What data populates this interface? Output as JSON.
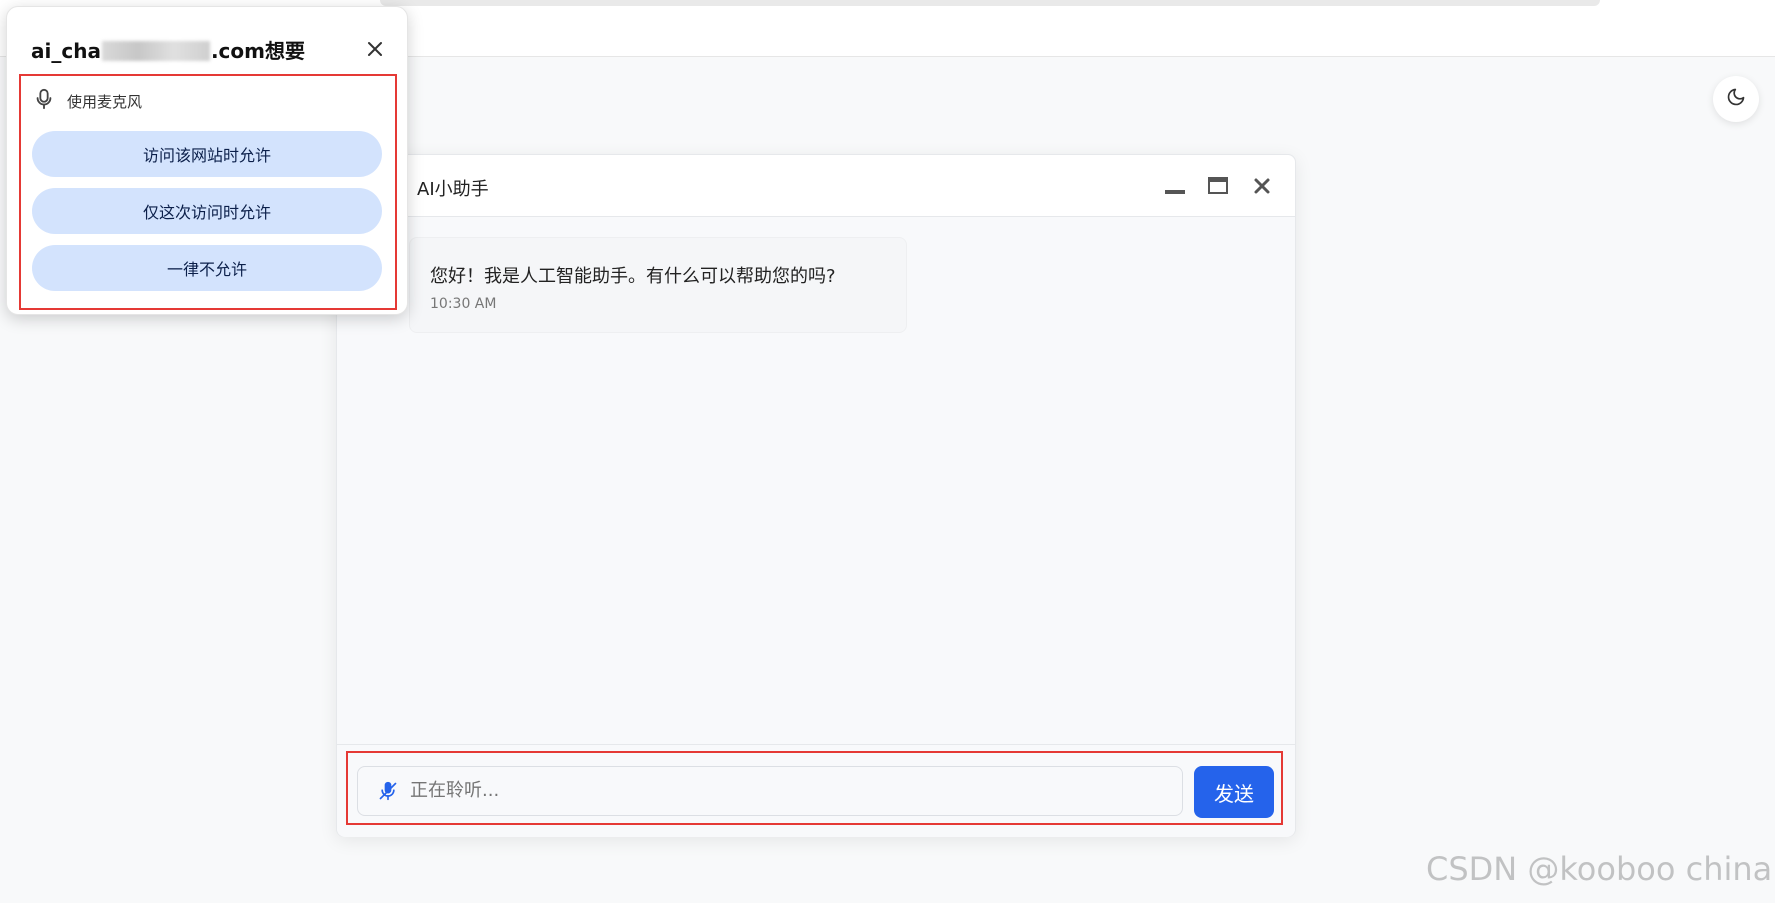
{
  "permission_popup": {
    "origin_prefix": "ai_cha",
    "origin_suffix": ".com想要",
    "permission_label": "使用麦克风",
    "buttons": [
      "访问该网站时允许",
      "仅这次访问时允许",
      "一律不允许"
    ],
    "close_icon": "close-icon",
    "mic_icon": "microphone-icon"
  },
  "chat": {
    "title": "AI小助手",
    "messages": [
      {
        "text": "您好！我是人工智能助手。有什么可以帮助您的吗?",
        "time": "10:30 AM"
      }
    ],
    "input_placeholder": "正在聆听...",
    "send_label": "发送",
    "window_icons": [
      "minimize-icon",
      "maximize-icon",
      "close-icon"
    ]
  },
  "theme_toggle_icon": "moon-icon",
  "watermark": "CSDN @kooboo china.",
  "colors": {
    "accent": "#2563eb",
    "permission_button": "#d3e3fd",
    "highlight_box": "#e53935"
  }
}
